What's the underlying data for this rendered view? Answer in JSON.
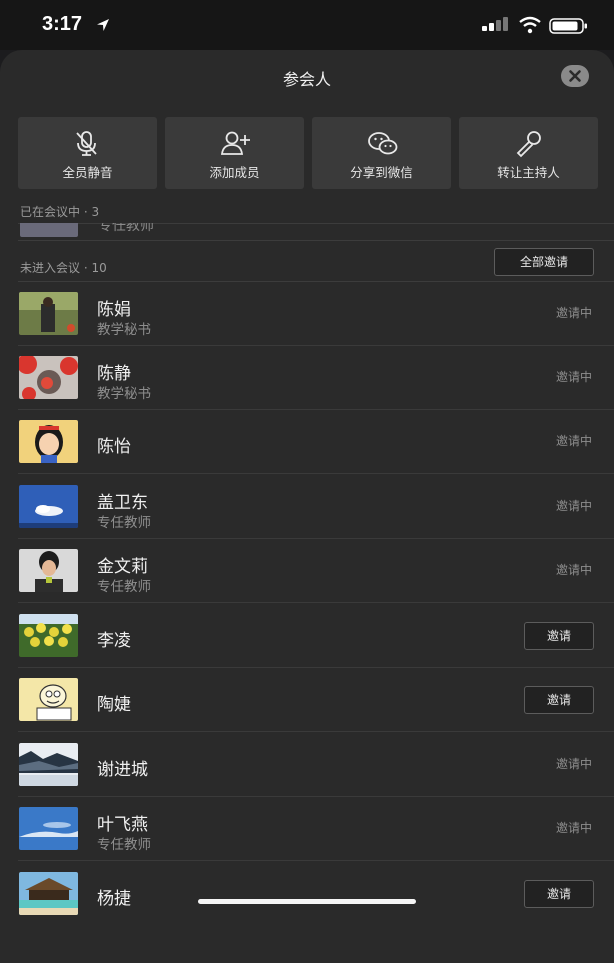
{
  "status_bar": {
    "time": "3:17"
  },
  "sheet": {
    "title": "参会人"
  },
  "actions": [
    {
      "label": "全员静音",
      "icon": "mic-muted-icon"
    },
    {
      "label": "添加成员",
      "icon": "add-member-icon"
    },
    {
      "label": "分享到微信",
      "icon": "wechat-icon"
    },
    {
      "label": "转让主持人",
      "icon": "microphone-icon"
    }
  ],
  "in_meeting": {
    "label": "已在会议中 · 3",
    "partial_sub": "专任教师"
  },
  "not_joined": {
    "label": "未进入会议 · 10",
    "invite_all_label": "全部邀请"
  },
  "members": [
    {
      "name": "陈娟",
      "sub": "教学秘书",
      "status": "邀请中",
      "button": ""
    },
    {
      "name": "陈静",
      "sub": "教学秘书",
      "status": "邀请中",
      "button": ""
    },
    {
      "name": "陈怡",
      "sub": "",
      "status": "邀请中",
      "button": ""
    },
    {
      "name": "盖卫东",
      "sub": "专任教师",
      "status": "邀请中",
      "button": ""
    },
    {
      "name": "金文莉",
      "sub": "专任教师",
      "status": "邀请中",
      "button": ""
    },
    {
      "name": "李凌",
      "sub": "",
      "status": "",
      "button": "邀请"
    },
    {
      "name": "陶婕",
      "sub": "",
      "status": "",
      "button": "邀请"
    },
    {
      "name": "谢进城",
      "sub": "",
      "status": "邀请中",
      "button": ""
    },
    {
      "name": "叶飞燕",
      "sub": "专任教师",
      "status": "邀请中",
      "button": ""
    },
    {
      "name": "杨捷",
      "sub": "",
      "status": "",
      "button": "邀请"
    }
  ],
  "colors": {
    "sheet_bg": "#2a2a2a",
    "button_bg": "#3a3a3a",
    "secondary_text": "#8e8e8e"
  }
}
